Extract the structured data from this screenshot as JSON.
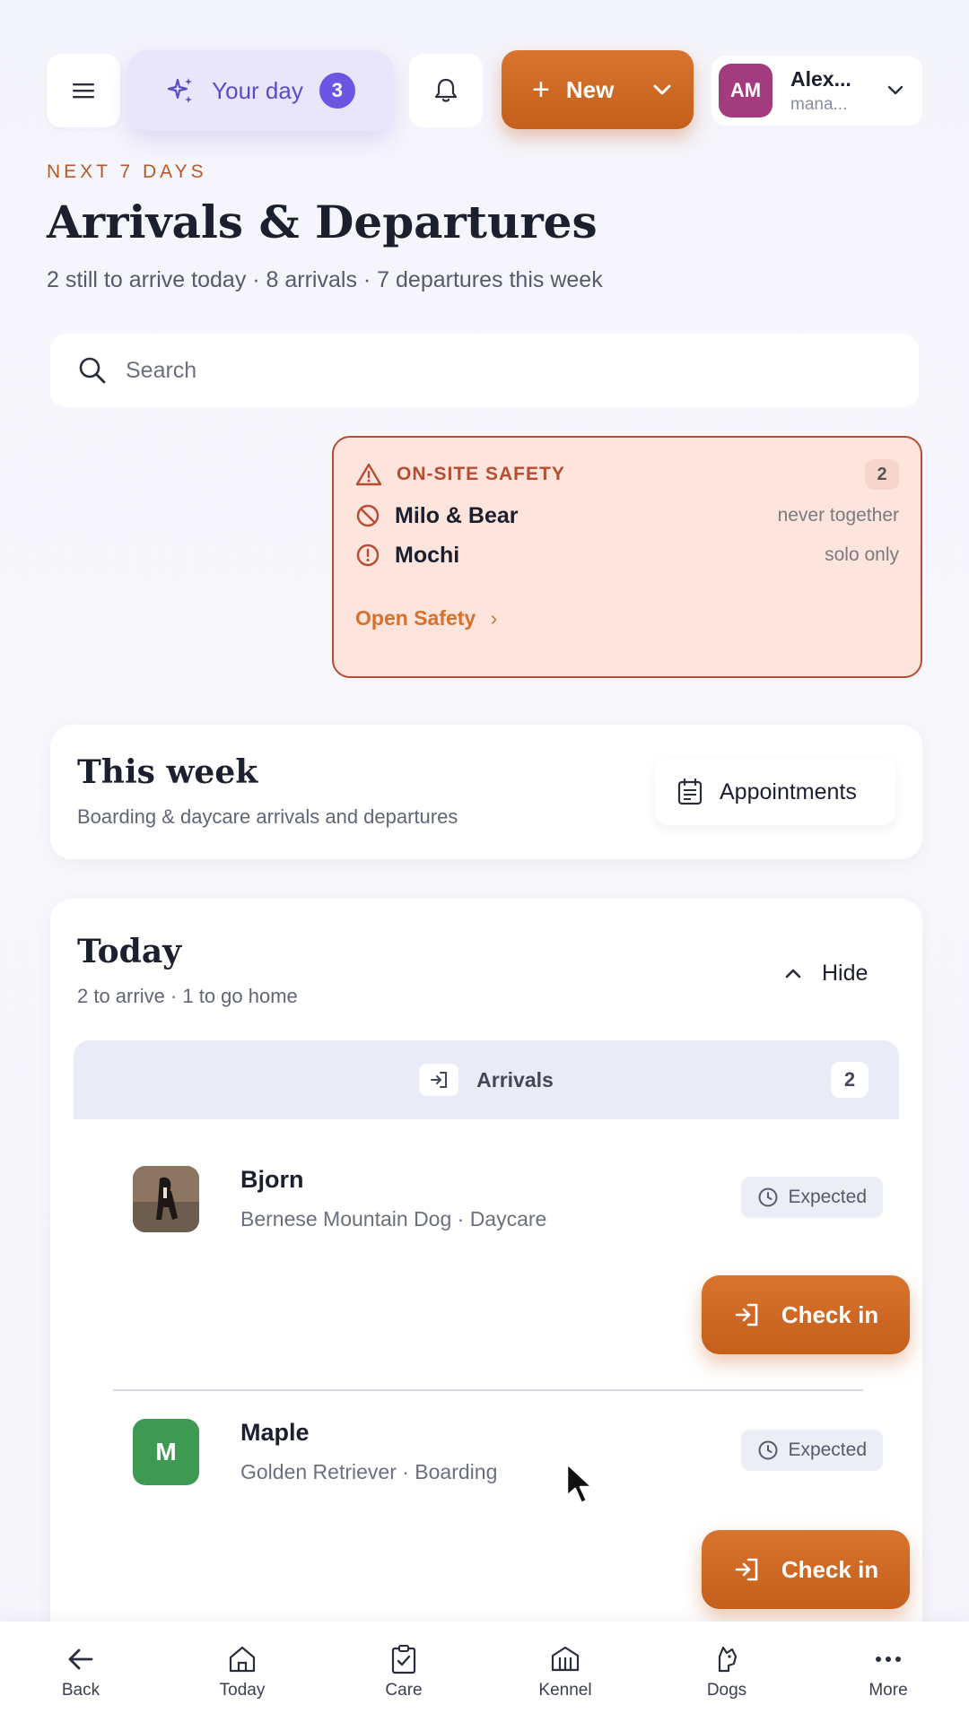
{
  "topbar": {
    "your_day_label": "Your day",
    "your_day_badge": "3",
    "new_label": "New",
    "user_initials": "AM",
    "user_name": "Alex...",
    "user_role": "mana..."
  },
  "header": {
    "eyebrow": "NEXT 7 DAYS",
    "title": "Arrivals & Departures",
    "subtitle": "2 still to arrive today · 8 arrivals · 7 departures this week"
  },
  "search": {
    "placeholder": "Search"
  },
  "safety": {
    "title": "ON-SITE SAFETY",
    "count": "2",
    "items": [
      {
        "name": "Milo & Bear",
        "note": "never together",
        "icon": "ban-icon"
      },
      {
        "name": "Mochi",
        "note": "solo only",
        "icon": "alert-circle-icon"
      }
    ],
    "link_label": "Open Safety"
  },
  "week": {
    "title": "This week",
    "subtitle": "Boarding & daycare arrivals and departures",
    "appointments_label": "Appointments"
  },
  "today": {
    "title": "Today",
    "subtitle": "2 to arrive · 1 to go home",
    "hide_label": "Hide",
    "arrivals_label": "Arrivals",
    "arrivals_count": "2",
    "dogs": [
      {
        "name": "Bjorn",
        "meta": "Bernese Mountain Dog · Daycare",
        "status": "Expected",
        "action": "Check in",
        "avatar": "photo"
      },
      {
        "name": "Maple",
        "meta": "Golden Retriever · Boarding",
        "status": "Expected",
        "action": "Check in",
        "avatar_letter": "M"
      }
    ]
  },
  "nav": {
    "items": [
      {
        "label": "Back",
        "icon": "arrow-left-icon"
      },
      {
        "label": "Today",
        "icon": "home-icon"
      },
      {
        "label": "Care",
        "icon": "clipboard-check-icon"
      },
      {
        "label": "Kennel",
        "icon": "kennel-icon"
      },
      {
        "label": "Dogs",
        "icon": "dog-icon"
      },
      {
        "label": "More",
        "icon": "more-dots-icon"
      }
    ]
  },
  "colors": {
    "accent": "#c9641f",
    "purple": "#6b55e3",
    "safety_bg": "#fde4dc",
    "safety_border": "#b44d32"
  }
}
